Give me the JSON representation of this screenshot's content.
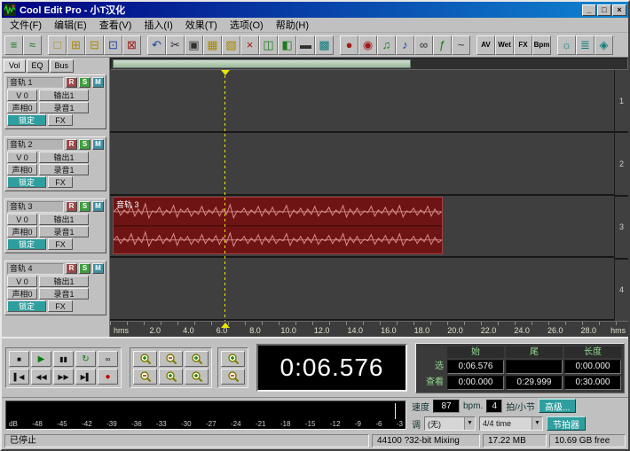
{
  "colors": {
    "chrome": "#c0c0c0",
    "titlebar1": "#000080",
    "titlebar2": "#1084d0",
    "trackbg": "#3f3f3f",
    "clipred": "#6e1414",
    "wavered": "#d98c8c",
    "playhead": "#e8e800",
    "teal": "#2f9e9e",
    "valgreen": "#8fd98f"
  },
  "window": {
    "title": "Cool Edit Pro - 小T汉化",
    "controls": {
      "min": "_",
      "max": "□",
      "close": "×"
    }
  },
  "menu": {
    "items": [
      "文件(F)",
      "编辑(E)",
      "查看(V)",
      "插入(I)",
      "效果(T)",
      "选项(O)",
      "帮助(H)"
    ]
  },
  "toolbar": {
    "buttons": [
      {
        "name": "multitrack-view",
        "glyph": "≡"
      },
      {
        "name": "waveform-view",
        "glyph": "≈"
      },
      {
        "name": "new-session",
        "glyph": "□"
      },
      {
        "name": "open-session",
        "glyph": "⊞"
      },
      {
        "name": "append-file",
        "glyph": "⊟"
      },
      {
        "name": "save-session",
        "glyph": "⊡"
      },
      {
        "name": "export-mixdown",
        "glyph": "⊠"
      },
      {
        "name": "undo",
        "glyph": "↶"
      },
      {
        "name": "cut",
        "glyph": "✂"
      },
      {
        "name": "copy",
        "glyph": "▣"
      },
      {
        "name": "paste",
        "glyph": "▦"
      },
      {
        "name": "mix-paste",
        "glyph": "▧"
      },
      {
        "name": "delete-block",
        "glyph": "×"
      },
      {
        "name": "split-block",
        "glyph": "◫"
      },
      {
        "name": "trim-block",
        "glyph": "◧"
      },
      {
        "name": "mute-block",
        "glyph": "▬"
      },
      {
        "name": "lock-time",
        "glyph": "▩"
      },
      {
        "name": "record-arm",
        "glyph": "●"
      },
      {
        "name": "punch-in",
        "glyph": "◉"
      },
      {
        "name": "insert-wave",
        "glyph": "♫"
      },
      {
        "name": "insert-midi",
        "glyph": "♪"
      },
      {
        "name": "loop-mode",
        "glyph": "∞"
      },
      {
        "name": "envelope-edit",
        "glyph": "ƒ"
      },
      {
        "name": "automation",
        "glyph": "~"
      },
      {
        "name": "av-sync",
        "glyph": "AV"
      },
      {
        "name": "wet-dry",
        "glyph": "Wet"
      },
      {
        "name": "fx-rack",
        "glyph": "FX"
      },
      {
        "name": "bpm-calculator",
        "glyph": "Bpm"
      },
      {
        "name": "metronome",
        "glyph": "☼"
      },
      {
        "name": "cue-list",
        "glyph": "≣"
      },
      {
        "name": "session-info",
        "glyph": "◈"
      }
    ]
  },
  "mixer": {
    "tabs": [
      "Vol",
      "EQ",
      "Bus"
    ],
    "rsm": {
      "r": "R",
      "s": "S",
      "m": "M"
    },
    "tracks": [
      {
        "name": "音轨 1",
        "vol": "V 0",
        "out": "输出1",
        "pan": "声相0",
        "rec": "录音1",
        "lock": "锁定",
        "fx": "FX"
      },
      {
        "name": "音轨 2",
        "vol": "V 0",
        "out": "输出1",
        "pan": "声相0",
        "rec": "录音1",
        "lock": "锁定",
        "fx": "FX"
      },
      {
        "name": "音轨 3",
        "vol": "V 0",
        "out": "输出1",
        "pan": "声相0",
        "rec": "录音1",
        "lock": "锁定",
        "fx": "FX"
      },
      {
        "name": "音轨 4",
        "vol": "V 0",
        "out": "输出1",
        "pan": "声相0",
        "rec": "录音1",
        "lock": "锁定",
        "fx": "FX"
      }
    ]
  },
  "timeline": {
    "clip_label": "音轨 3",
    "track_numbers": [
      "1",
      "2",
      "3",
      "4"
    ],
    "ruler": [
      "hms",
      "2.0",
      "4.0",
      "6.0",
      "8.0",
      "10.0",
      "12.0",
      "14.0",
      "16.0",
      "18.0",
      "20.0",
      "22.0",
      "24.0",
      "26.0",
      "28.0",
      "hms"
    ]
  },
  "transport": {
    "buttons": [
      {
        "name": "stop",
        "glyph": "■"
      },
      {
        "name": "play",
        "glyph": "▶"
      },
      {
        "name": "pause",
        "glyph": "▮▮"
      },
      {
        "name": "play-looped",
        "glyph": "↻"
      },
      {
        "name": "loop",
        "glyph": "∞"
      },
      {
        "name": "go-to-start",
        "glyph": "▌◀"
      },
      {
        "name": "rewind",
        "glyph": "◀◀"
      },
      {
        "name": "fast-forward",
        "glyph": "▶▶"
      },
      {
        "name": "go-to-end",
        "glyph": "▶▌"
      },
      {
        "name": "record",
        "glyph": "●"
      }
    ],
    "time_display": "0:06.576"
  },
  "selection": {
    "headers": [
      "始",
      "尾",
      "长度"
    ],
    "rows": [
      {
        "label": "选",
        "start": "0:06.576",
        "end": "",
        "length": "0:00.000"
      },
      {
        "label": "查看",
        "start": "0:00.000",
        "end": "0:29.999",
        "length": "0:30.000"
      }
    ]
  },
  "meter": {
    "labels": [
      "dB",
      "-48",
      "-45",
      "-42",
      "-39",
      "-36",
      "-33",
      "-30",
      "-27",
      "-24",
      "-21",
      "-18",
      "-15",
      "-12",
      "-9",
      "-6",
      "-3"
    ]
  },
  "tempo": {
    "speed_label": "速度",
    "bpm_value": "87",
    "bpm_unit": "bpm.",
    "beats_value": "4",
    "beats_unit": "拍/小节",
    "advanced_button": "高级...",
    "key_label": "调",
    "key_value": "(无)",
    "time_sig_value": "4/4 time",
    "metronome_button": "节拍器"
  },
  "status": {
    "state": "已停止",
    "format": "44100 ?32-bit Mixing",
    "memory": "17.22 MB",
    "disk": "10.69 GB free"
  }
}
